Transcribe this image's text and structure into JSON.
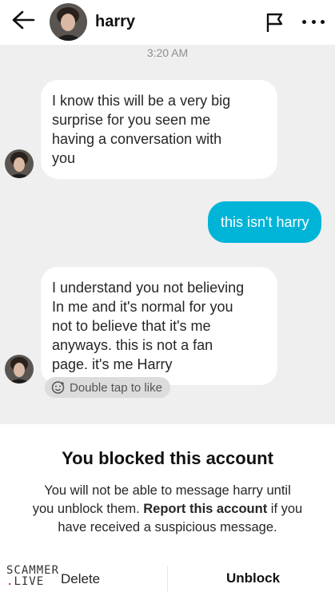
{
  "header": {
    "name": "harry",
    "icons": {
      "back": "arrow-left-icon",
      "flag": "flag-icon",
      "more": "more-dots-icon"
    }
  },
  "conversation": {
    "timestamp": "3:20 AM",
    "messages": [
      {
        "from": "harry",
        "lines": [
          "I know this will be a very big",
          "surprise for you seen me",
          "having a conversation with",
          "you"
        ]
      },
      {
        "from": "me",
        "lines": [
          "this isn't harry"
        ]
      },
      {
        "from": "harry",
        "lines": [
          "I understand you not believing",
          "In me and it's normal for you",
          "not to believe that it's me",
          "anyways. this is not a fan",
          "page. it's me Harry"
        ]
      }
    ],
    "like_hint": "Double tap to like"
  },
  "blocked_notice": {
    "title": "You blocked this account",
    "line1": "You will not be able to message harry until",
    "line2_a": "you unblock them.",
    "line2_bold": "Report this account",
    "line2_b": "if you",
    "line3": "have received a suspicious message.",
    "delete_label": "Delete",
    "unblock_label": "Unblock"
  },
  "watermark": {
    "top": "SCAMMER",
    "bottom": "LIVE"
  },
  "colors": {
    "outgoing_bubble": "#00b4d8",
    "incoming_bubble": "#ffffff",
    "background": "#efefef"
  }
}
